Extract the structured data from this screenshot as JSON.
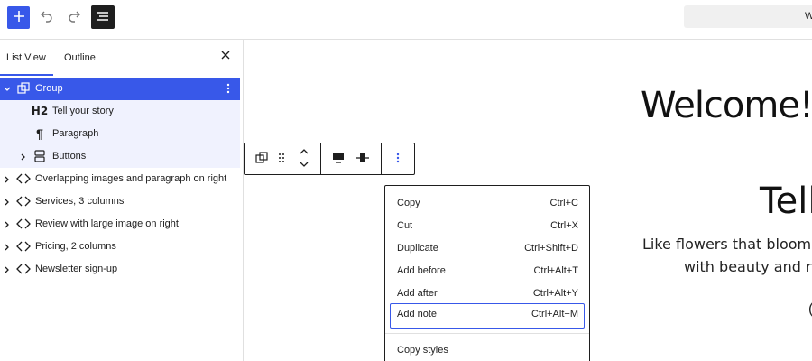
{
  "toolbar": {
    "add_icon": "plus-icon",
    "undo_icon": "undo-icon",
    "redo_icon": "redo-icon",
    "list_view_icon": "list-view-icon",
    "doc_bar_text": "W",
    "accent_color": "#3858e9"
  },
  "sidebar": {
    "tabs": [
      {
        "label": "List View",
        "active": true
      },
      {
        "label": "Outline",
        "active": false
      }
    ],
    "close_icon": "close-icon",
    "items": [
      {
        "label": "Group",
        "icon": "group-icon",
        "expanded": true,
        "selected": true
      },
      {
        "label": "Tell your story",
        "icon": "heading-icon",
        "icon_text": "H2",
        "level": 2
      },
      {
        "label": "Paragraph",
        "icon": "paragraph-icon",
        "icon_text": "¶",
        "level": 2
      },
      {
        "label": "Buttons",
        "icon": "buttons-icon",
        "level": 2,
        "expandable": true
      },
      {
        "label": "Overlapping images and paragraph on right",
        "icon": "pattern-icon"
      },
      {
        "label": "Services, 3 columns",
        "icon": "pattern-icon"
      },
      {
        "label": "Review with large image on right",
        "icon": "pattern-icon"
      },
      {
        "label": "Pricing, 2 columns",
        "icon": "pattern-icon"
      },
      {
        "label": "Newsletter sign-up",
        "icon": "pattern-icon"
      }
    ]
  },
  "canvas": {
    "heading": "Welcome!",
    "subheading": "Tell",
    "line1": "Like flowers that bloom in",
    "line2": "with beauty and re",
    "partial": "("
  },
  "block_toolbar": {
    "items": [
      "group-icon",
      "drag-handle-icon",
      "move-up-down-icon",
      "align-top-icon",
      "justify-center-icon",
      "options-icon"
    ]
  },
  "context_menu": {
    "items": [
      {
        "label": "Copy",
        "shortcut": "Ctrl+C"
      },
      {
        "label": "Cut",
        "shortcut": "Ctrl+X"
      },
      {
        "label": "Duplicate",
        "shortcut": "Ctrl+Shift+D"
      },
      {
        "label": "Add before",
        "shortcut": "Ctrl+Alt+T"
      },
      {
        "label": "Add after",
        "shortcut": "Ctrl+Alt+Y"
      },
      {
        "label": "Add note",
        "shortcut": "Ctrl+Alt+M",
        "focused": true
      },
      {
        "label": "Copy styles",
        "shortcut": ""
      }
    ]
  }
}
